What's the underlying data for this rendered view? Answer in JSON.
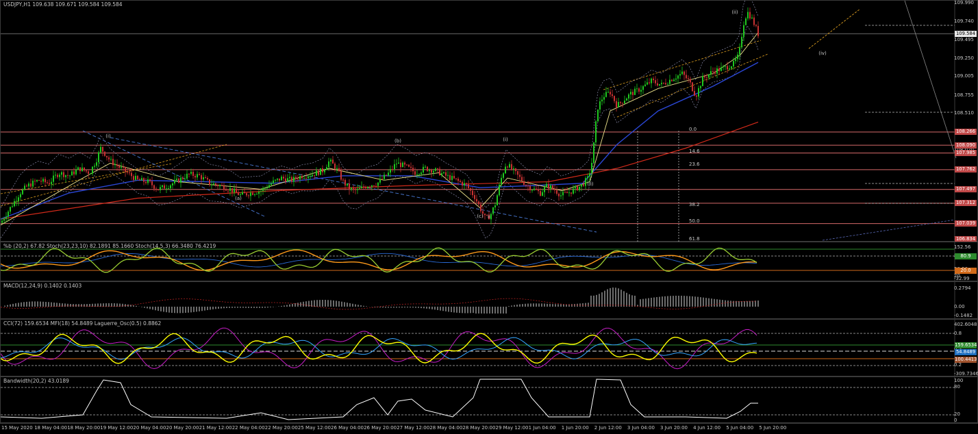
{
  "colors": {
    "bg": "#000000",
    "bull": "#1fc71f",
    "bear": "#c83232",
    "ma_fast": "#f0e68c",
    "ma_mid": "#2b47d6",
    "ma_slow": "#d22a1a",
    "hline": "#d56a6a",
    "stoch_main": "#9acd32",
    "stoch_sig": "#ff9a1a",
    "stoch_blue": "#2a6ad6",
    "cci": "#c71ec7",
    "mfi": "#35a6ff",
    "laguerre": "#ffff00",
    "band": "#ffffff"
  },
  "main": {
    "title": "USDJPY,H1  109.638 109.671 109.584 109.584",
    "current_price": "109.584",
    "price_scale": [
      "109.990",
      "109.740",
      "109.495",
      "109.250",
      "109.005",
      "108.755",
      "108.510",
      "108.266",
      "108.020",
      "107.985",
      "107.762",
      "107.497",
      "107.312",
      "107.039",
      "106.834"
    ],
    "price_tags": [
      "108.266",
      "108.090",
      "107.985",
      "107.762",
      "107.497",
      "107.312",
      "107.039",
      "106.834"
    ],
    "fib_labels": [
      "0.0",
      "14.6",
      "23.6",
      "38.2",
      "50.0",
      "61.8"
    ],
    "wave_labels": [
      "(a)",
      "(b)",
      "(c)",
      "ii",
      "(i)",
      "(ii)",
      "(ii)",
      "(iv)",
      "(i)"
    ]
  },
  "stoch": {
    "title": "%b (20,2) 67.82  Stoch(23,23,10) 82.1891 85.1660  Stoch(14,5,3) 66.3480 76.4219",
    "scale": [
      "152.56",
      "80",
      "50.50",
      "20",
      "-32.99"
    ],
    "tags": [
      "80.9",
      "20.0"
    ]
  },
  "macd": {
    "title": "MACD(12,24,9) 0.1402 0.1403",
    "scale": [
      "0.2794",
      "0.00",
      "-0.1482"
    ]
  },
  "cci": {
    "title": "CCI(72) 159.6534  MFI(18) 54.8489  Laguerre_Osc(0.5) 0.8862",
    "scale": [
      "402.6048",
      "0.8",
      "0.5",
      "0.2",
      "-309.7346"
    ],
    "tags": [
      "159.6534",
      "54.8489",
      "100.4413"
    ]
  },
  "bandwidth": {
    "title": "Bandwidth(20,2) 43.0189",
    "scale": [
      "100",
      "80",
      "20",
      "0"
    ]
  },
  "x_axis": [
    "15 May 2020",
    "18 May 04:00",
    "18 May 20:00",
    "19 May 12:00",
    "20 May 04:00",
    "20 May 20:00",
    "21 May 12:00",
    "22 May 04:00",
    "22 May 20:00",
    "25 May 12:00",
    "26 May 04:00",
    "26 May 20:00",
    "27 May 12:00",
    "28 May 04:00",
    "28 May 20:00",
    "29 May 12:00",
    "1 Jun 04:00",
    "1 Jun 20:00",
    "2 Jun 12:00",
    "3 Jun 04:00",
    "3 Jun 20:00",
    "4 Jun 12:00",
    "5 Jun 04:00",
    "5 Jun 20:00"
  ],
  "chart_data": {
    "type": "candlestick",
    "symbol": "USDJPY",
    "timeframe": "H1",
    "ylim": [
      106.834,
      109.99
    ],
    "close_path": [
      [
        0,
        107.05
      ],
      [
        14,
        107.25
      ],
      [
        28,
        107.45
      ],
      [
        40,
        107.55
      ],
      [
        55,
        107.62
      ],
      [
        70,
        107.58
      ],
      [
        85,
        107.72
      ],
      [
        100,
        107.68
      ],
      [
        115,
        107.78
      ],
      [
        130,
        107.72
      ],
      [
        140,
        107.9
      ],
      [
        146,
        108.05
      ],
      [
        152,
        107.98
      ],
      [
        160,
        107.88
      ],
      [
        172,
        107.8
      ],
      [
        185,
        107.72
      ],
      [
        200,
        107.62
      ],
      [
        215,
        107.6
      ],
      [
        230,
        107.5
      ],
      [
        245,
        107.55
      ],
      [
        260,
        107.62
      ],
      [
        275,
        107.7
      ],
      [
        290,
        107.68
      ],
      [
        305,
        107.58
      ],
      [
        320,
        107.55
      ],
      [
        335,
        107.5
      ],
      [
        350,
        107.42
      ],
      [
        365,
        107.45
      ],
      [
        380,
        107.48
      ],
      [
        395,
        107.58
      ],
      [
        410,
        107.65
      ],
      [
        425,
        107.62
      ],
      [
        440,
        107.68
      ],
      [
        455,
        107.7
      ],
      [
        470,
        107.75
      ],
      [
        480,
        107.88
      ],
      [
        490,
        107.78
      ],
      [
        500,
        107.6
      ],
      [
        510,
        107.5
      ],
      [
        520,
        107.48
      ],
      [
        535,
        107.55
      ],
      [
        550,
        107.58
      ],
      [
        565,
        107.7
      ],
      [
        578,
        107.85
      ],
      [
        592,
        107.8
      ],
      [
        606,
        107.72
      ],
      [
        620,
        107.78
      ],
      [
        635,
        107.75
      ],
      [
        650,
        107.68
      ],
      [
        665,
        107.62
      ],
      [
        680,
        107.55
      ],
      [
        692,
        107.4
      ],
      [
        700,
        107.25
      ],
      [
        708,
        107.1
      ],
      [
        715,
        107.15
      ],
      [
        722,
        107.3
      ],
      [
        730,
        107.62
      ],
      [
        738,
        107.85
      ],
      [
        748,
        107.75
      ],
      [
        758,
        107.65
      ],
      [
        768,
        107.55
      ],
      [
        778,
        107.5
      ],
      [
        788,
        107.45
      ],
      [
        798,
        107.55
      ],
      [
        808,
        107.5
      ],
      [
        818,
        107.42
      ],
      [
        828,
        107.45
      ],
      [
        838,
        107.5
      ],
      [
        848,
        107.55
      ],
      [
        858,
        107.65
      ],
      [
        864,
        107.9
      ],
      [
        868,
        108.3
      ],
      [
        872,
        108.6
      ],
      [
        880,
        108.75
      ],
      [
        890,
        108.8
      ],
      [
        900,
        108.62
      ],
      [
        910,
        108.7
      ],
      [
        920,
        108.78
      ],
      [
        935,
        108.85
      ],
      [
        950,
        108.95
      ],
      [
        965,
        108.9
      ],
      [
        980,
        108.98
      ],
      [
        995,
        109.05
      ],
      [
        1005,
        108.95
      ],
      [
        1015,
        108.75
      ],
      [
        1025,
        108.98
      ],
      [
        1040,
        109.08
      ],
      [
        1055,
        109.12
      ],
      [
        1070,
        109.18
      ],
      [
        1078,
        109.3
      ],
      [
        1084,
        109.7
      ],
      [
        1090,
        109.88
      ],
      [
        1096,
        109.8
      ],
      [
        1102,
        109.68
      ],
      [
        1106,
        109.58
      ]
    ],
    "ma_fast_path": [
      [
        0,
        107.02
      ],
      [
        120,
        107.65
      ],
      [
        160,
        107.85
      ],
      [
        260,
        107.6
      ],
      [
        380,
        107.5
      ],
      [
        480,
        107.78
      ],
      [
        560,
        107.62
      ],
      [
        640,
        107.72
      ],
      [
        700,
        107.25
      ],
      [
        740,
        107.65
      ],
      [
        820,
        107.48
      ],
      [
        860,
        107.6
      ],
      [
        890,
        108.55
      ],
      [
        960,
        108.85
      ],
      [
        1040,
        109.05
      ],
      [
        1080,
        109.3
      ],
      [
        1106,
        109.6
      ]
    ],
    "ma_mid_path": [
      [
        0,
        107.1
      ],
      [
        100,
        107.45
      ],
      [
        200,
        107.62
      ],
      [
        300,
        107.6
      ],
      [
        400,
        107.58
      ],
      [
        500,
        107.68
      ],
      [
        600,
        107.68
      ],
      [
        700,
        107.52
      ],
      [
        780,
        107.55
      ],
      [
        850,
        107.58
      ],
      [
        900,
        108.1
      ],
      [
        960,
        108.55
      ],
      [
        1040,
        108.88
      ],
      [
        1106,
        109.2
      ]
    ],
    "ma_slow_path": [
      [
        0,
        107.1
      ],
      [
        200,
        107.38
      ],
      [
        400,
        107.48
      ],
      [
        600,
        107.55
      ],
      [
        800,
        107.6
      ],
      [
        900,
        107.78
      ],
      [
        1000,
        108.05
      ],
      [
        1106,
        108.4
      ]
    ],
    "horizontal_levels": [
      108.266,
      108.09,
      107.985,
      107.762,
      107.497,
      107.312,
      107.039
    ],
    "current_price_level": 109.584
  }
}
